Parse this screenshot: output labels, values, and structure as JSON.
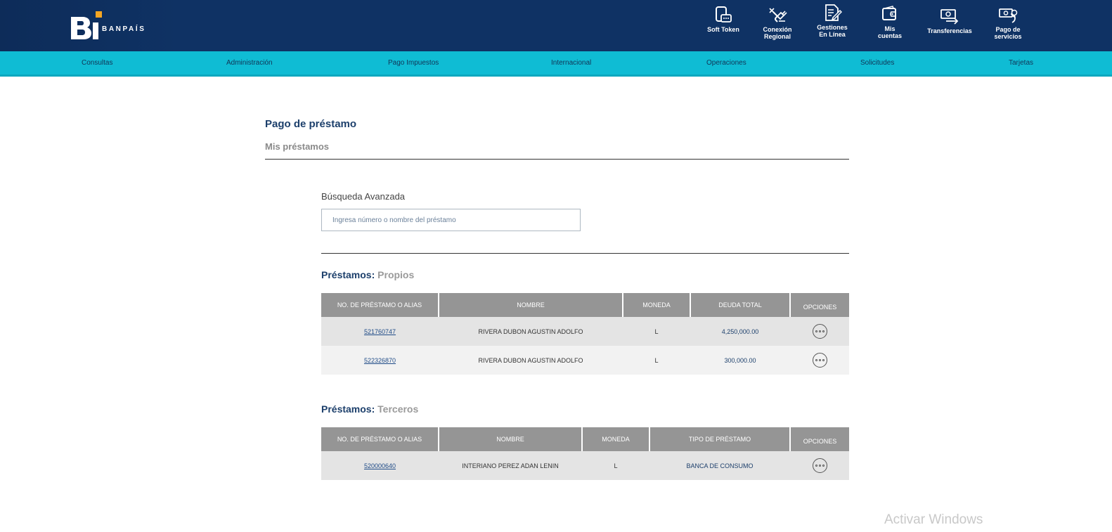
{
  "brand": {
    "name": "BANPAÍS",
    "colors": {
      "navy": "#0f3264",
      "cyan": "#0fbcd4",
      "accent_orange": "#f5a623"
    }
  },
  "top_nav": [
    {
      "label": "Soft Token",
      "icon": "phone-token-icon"
    },
    {
      "label": "Conexión\nRegional",
      "icon": "plug-icon"
    },
    {
      "label": "Gestiones\nEn Línea",
      "icon": "document-edit-icon"
    },
    {
      "label": "Mis\ncuentas",
      "icon": "wallet-icon"
    },
    {
      "label": "Transferencias",
      "icon": "money-transfer-icon"
    },
    {
      "label": "Pago de\nservicios",
      "icon": "bill-pay-icon"
    }
  ],
  "menu": [
    "Consultas",
    "Administración",
    "Pago Impuestos",
    "Internacional",
    "Operaciones",
    "Solicitudes",
    "Tarjetas"
  ],
  "page": {
    "title": "Pago de préstamo",
    "subtitle": "Mis préstamos"
  },
  "search": {
    "label": "Búsqueda Avanzada",
    "placeholder": "Ingresa número o nombre del préstamo",
    "value": ""
  },
  "own_loans": {
    "title_prefix": "Préstamos:",
    "title_suffix": "Propios",
    "columns": [
      "NO. DE PRÉSTAMO O ALIAS",
      "NOMBRE",
      "MONEDA",
      "DEUDA TOTAL",
      "OPCIONES"
    ],
    "rows": [
      {
        "number": "521760747",
        "name": "RIVERA DUBON AGUSTIN ADOLFO",
        "currency": "L",
        "debt": "4,250,000.00"
      },
      {
        "number": "522326870",
        "name": "RIVERA DUBON AGUSTIN ADOLFO",
        "currency": "L",
        "debt": "300,000.00"
      }
    ]
  },
  "third_party_loans": {
    "title_prefix": "Préstamos:",
    "title_suffix": "Terceros",
    "columns": [
      "NO. DE PRÉSTAMO O ALIAS",
      "NOMBRE",
      "MONEDA",
      "TIPO DE PRÉSTAMO",
      "OPCIONES"
    ],
    "rows": [
      {
        "number": "520000640",
        "name": "INTERIANO PEREZ ADAN LENIN",
        "currency": "L",
        "type": "BANCA DE CONSUMO"
      }
    ]
  },
  "watermark": "Activar Windows"
}
